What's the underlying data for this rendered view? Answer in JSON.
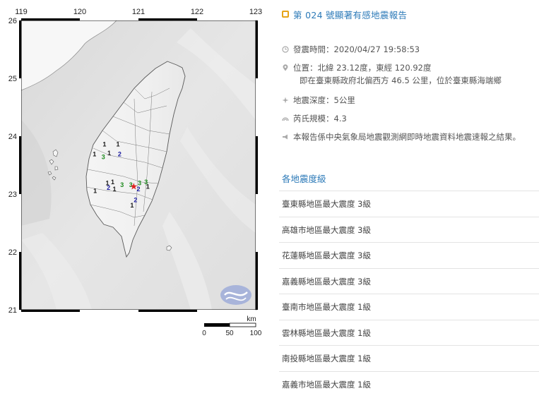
{
  "map": {
    "lon_labels": [
      "119",
      "120",
      "121",
      "122",
      "123"
    ],
    "lat_labels": [
      "26",
      "25",
      "24",
      "23",
      "22",
      "21"
    ],
    "scale_unit": "km",
    "scale_ticks": [
      "0",
      "50",
      "100"
    ],
    "epicenter": {
      "lat": 23.12,
      "lon": 120.92
    },
    "intensity_labels": [
      {
        "value": "1",
        "lat": 23.85,
        "lon": 120.42,
        "color": "#1a1a1a"
      },
      {
        "value": "1",
        "lat": 23.85,
        "lon": 120.65,
        "color": "#1a1a1a"
      },
      {
        "value": "1",
        "lat": 23.68,
        "lon": 120.25,
        "color": "#1a1a1a"
      },
      {
        "value": "1",
        "lat": 23.7,
        "lon": 120.5,
        "color": "#1a1a1a"
      },
      {
        "value": "3",
        "lat": 23.63,
        "lon": 120.4,
        "color": "#1f8b1f"
      },
      {
        "value": "2",
        "lat": 23.68,
        "lon": 120.68,
        "color": "#1c1ca0"
      },
      {
        "value": "1",
        "lat": 23.18,
        "lon": 120.47,
        "color": "#1a1a1a"
      },
      {
        "value": "1",
        "lat": 23.2,
        "lon": 120.56,
        "color": "#1a1a1a"
      },
      {
        "value": "2",
        "lat": 23.1,
        "lon": 120.49,
        "color": "#1c1ca0"
      },
      {
        "value": "3",
        "lat": 23.15,
        "lon": 120.72,
        "color": "#1f8b1f"
      },
      {
        "value": "3",
        "lat": 23.15,
        "lon": 120.87,
        "color": "#1f8b1f"
      },
      {
        "value": "3",
        "lat": 23.18,
        "lon": 121.02,
        "color": "#1f8b1f"
      },
      {
        "value": "3",
        "lat": 23.2,
        "lon": 121.13,
        "color": "#1f8b1f"
      },
      {
        "value": "2",
        "lat": 23.08,
        "lon": 121.0,
        "color": "#1c1ca0"
      },
      {
        "value": "1",
        "lat": 23.08,
        "lon": 120.59,
        "color": "#1a1a1a"
      },
      {
        "value": "1",
        "lat": 23.05,
        "lon": 120.26,
        "color": "#1a1a1a"
      },
      {
        "value": "1",
        "lat": 23.12,
        "lon": 121.16,
        "color": "#1a1a1a"
      },
      {
        "value": "2",
        "lat": 22.89,
        "lon": 120.95,
        "color": "#1c1ca0"
      },
      {
        "value": "1",
        "lat": 22.8,
        "lon": 120.89,
        "color": "#1a1a1a"
      }
    ]
  },
  "report": {
    "title": "第 024 號顯著有感地震報告",
    "time_label": "發震時間：",
    "time_value": "2020/04/27 19:58:53",
    "location_label": "位置：",
    "location_value": "北緯 23.12度，東經 120.92度",
    "location_detail": "即在臺東縣政府北偏西方 46.5 公里，位於臺東縣海端鄉",
    "depth_label": "地震深度：",
    "depth_value": "5公里",
    "magnitude_label": "芮氏規模：",
    "magnitude_value": "4.3",
    "note": "本報告係中央氣象局地震觀測網即時地震資料地震速報之結果。"
  },
  "intensity_section": {
    "title": "各地震度級",
    "items": [
      "臺東縣地區最大震度 3級",
      "高雄市地區最大震度 3級",
      "花蓮縣地區最大震度 3級",
      "嘉義縣地區最大震度 3級",
      "臺南市地區最大震度 1級",
      "雲林縣地區最大震度 1級",
      "南投縣地區最大震度 1級",
      "嘉義市地區最大震度 1級"
    ]
  },
  "colors": {
    "accent": "#2c7ab8",
    "title_icon": "#e6a417",
    "epicenter": "#e02020",
    "intensity_1": "#1a1a1a",
    "intensity_2": "#1c1ca0",
    "intensity_3": "#1f8b1f"
  }
}
